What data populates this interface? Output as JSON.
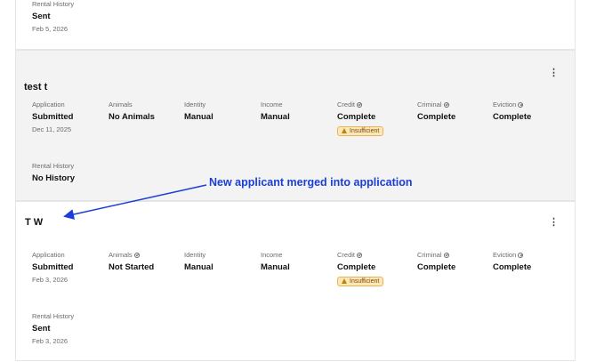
{
  "top_card": {
    "rental_history": {
      "label": "Rental History",
      "value": "Sent",
      "date": "Feb 5, 2026"
    }
  },
  "mid_card": {
    "name": "test t",
    "kebab": "⋮",
    "application": {
      "label": "Application",
      "value": "Submitted",
      "date": "Dec 11, 2025"
    },
    "animals": {
      "label": "Animals",
      "value": "No Animals"
    },
    "identity": {
      "label": "Identity",
      "value": "Manual"
    },
    "income": {
      "label": "Income",
      "value": "Manual"
    },
    "credit": {
      "label": "Credit",
      "value": "Complete",
      "badge": "Insufficient"
    },
    "criminal": {
      "label": "Criminal",
      "value": "Complete"
    },
    "eviction": {
      "label": "Eviction",
      "value": "Complete"
    },
    "rental_history": {
      "label": "Rental History",
      "value": "No History"
    }
  },
  "annotation": "New applicant merged into application",
  "bot_card": {
    "name": "T W",
    "kebab": "⋮",
    "application": {
      "label": "Application",
      "value": "Submitted",
      "date": "Feb 3, 2026"
    },
    "animals": {
      "label": "Animals",
      "value": "Not Started"
    },
    "identity": {
      "label": "Identity",
      "value": "Manual"
    },
    "income": {
      "label": "Income",
      "value": "Manual"
    },
    "credit": {
      "label": "Credit",
      "value": "Complete",
      "badge": "Insufficient"
    },
    "criminal": {
      "label": "Criminal",
      "value": "Complete"
    },
    "eviction": {
      "label": "Eviction",
      "value": "Complete"
    },
    "rental_history": {
      "label": "Rental History",
      "value": "Sent",
      "date": "Feb 3, 2026"
    }
  },
  "colors": {
    "annotation": "#1a3fd6",
    "badge_bg": "#fde7b8",
    "mid_card_bg": "#f3f3f3"
  }
}
